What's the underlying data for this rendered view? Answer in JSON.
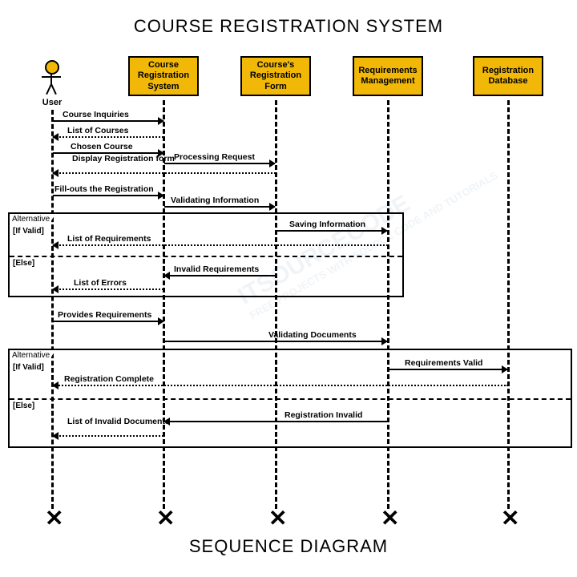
{
  "title": "COURSE REGISTRATION SYSTEM",
  "footer": "SEQUENCE DIAGRAM",
  "actor": {
    "label": "User"
  },
  "participants": {
    "p1": "Course Registration System",
    "p2": "Course's Registration Form",
    "p3": "Requirements Management",
    "p4": "Registration Database"
  },
  "messages": {
    "m1": "Course Inquiries",
    "m2": "List of Courses",
    "m3": "Chosen Course",
    "m4": "Processing Request",
    "m5": "Display Registration form",
    "m6": "Fill-outs the Registration",
    "m7": "Validating Information",
    "m8": "Saving Information",
    "m9": "List of Requirements",
    "m10": "Invalid Requirements",
    "m11": "List of Errors",
    "m12": "Provides Requirements",
    "m13": "Validating Documents",
    "m14": "Requirements  Valid",
    "m15": "Registration Complete",
    "m16": "Registration Invalid",
    "m17": "List of Invalid Documents"
  },
  "alt": {
    "label": "Alternative",
    "guard1": "[If Valid]",
    "guard2": "[Else]"
  },
  "watermark": {
    "line1": "ITSOURCECODE",
    "line2": "FREE PROJECTS WITH SOURCE CODE AND TUTORIALS"
  }
}
